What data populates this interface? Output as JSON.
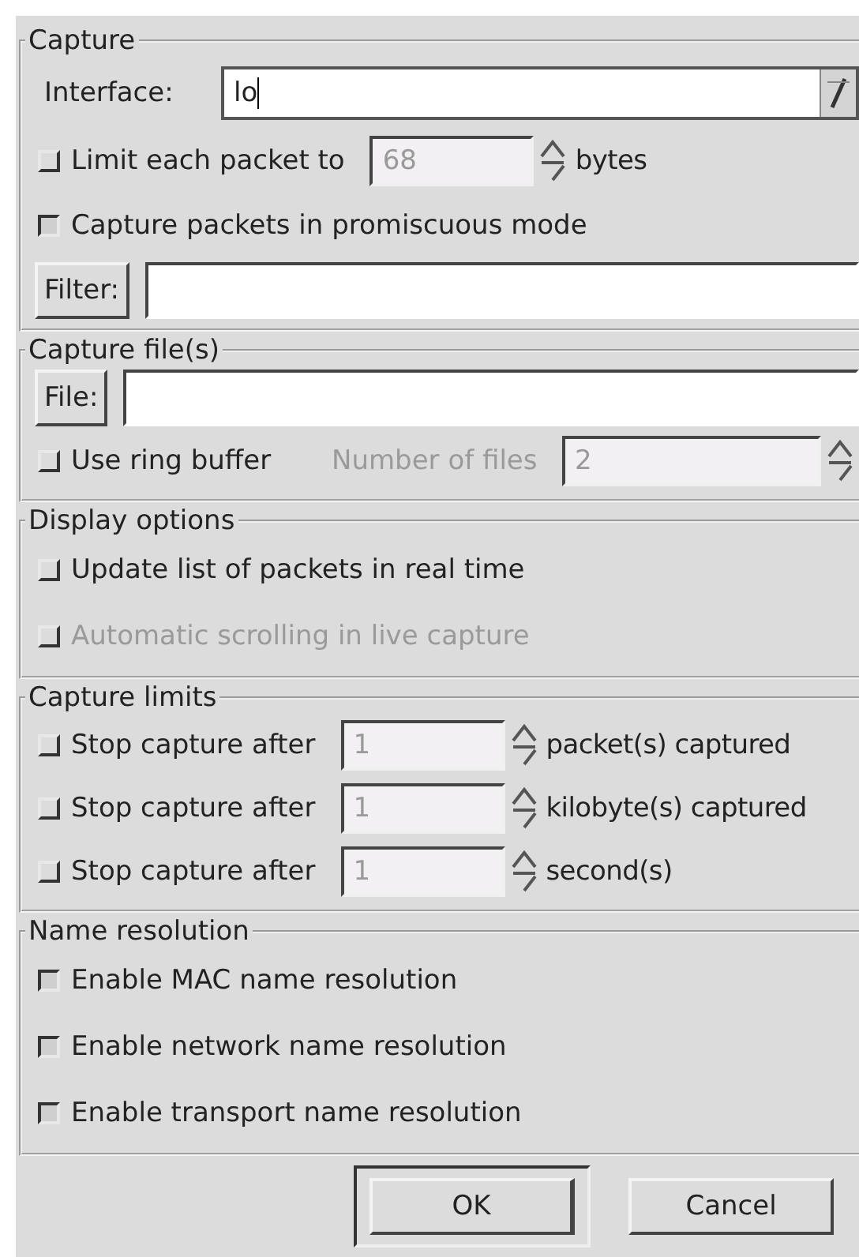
{
  "sections": [
    {
      "title": "Capture",
      "rows": [
        {
          "kind": "combo",
          "label": "Interface:",
          "value": "lo"
        },
        {
          "kind": "spin-check",
          "checked": false,
          "label": "Limit each packet to",
          "value": "68",
          "disabled": true,
          "unit": "bytes"
        },
        {
          "kind": "check",
          "checked": true,
          "label": "Capture packets in promiscuous mode",
          "disabled": false
        },
        {
          "kind": "button-entry",
          "button": "Filter:",
          "value": ""
        }
      ]
    },
    {
      "title": "Capture file(s)",
      "rows": [
        {
          "kind": "button-entry",
          "button": "File:",
          "value": ""
        },
        {
          "kind": "ring",
          "checked": false,
          "label": "Use ring buffer",
          "field_label": "Number of files",
          "value": "2",
          "disabled": true
        }
      ]
    },
    {
      "title": "Display options",
      "rows": [
        {
          "kind": "check",
          "checked": false,
          "label": "Update list of packets in real time",
          "disabled": false
        },
        {
          "kind": "check",
          "checked": false,
          "label": "Automatic scrolling in live capture",
          "disabled": true
        }
      ]
    },
    {
      "title": "Capture limits",
      "rows": [
        {
          "kind": "spin-check",
          "checked": false,
          "label": "Stop capture after",
          "value": "1",
          "disabled": true,
          "unit": "packet(s) captured"
        },
        {
          "kind": "spin-check",
          "checked": false,
          "label": "Stop capture after",
          "value": "1",
          "disabled": true,
          "unit": "kilobyte(s) captured"
        },
        {
          "kind": "spin-check",
          "checked": false,
          "label": "Stop capture after",
          "value": "1",
          "disabled": true,
          "unit": "second(s)"
        }
      ]
    },
    {
      "title": "Name resolution",
      "rows": [
        {
          "kind": "check",
          "checked": true,
          "label": "Enable MAC name resolution",
          "disabled": false
        },
        {
          "kind": "check",
          "checked": true,
          "label": "Enable network name resolution",
          "disabled": false
        },
        {
          "kind": "check",
          "checked": true,
          "label": "Enable transport name resolution",
          "disabled": false
        }
      ]
    }
  ],
  "buttons": [
    {
      "label": "OK",
      "default": true
    },
    {
      "label": "Cancel",
      "default": false
    }
  ]
}
